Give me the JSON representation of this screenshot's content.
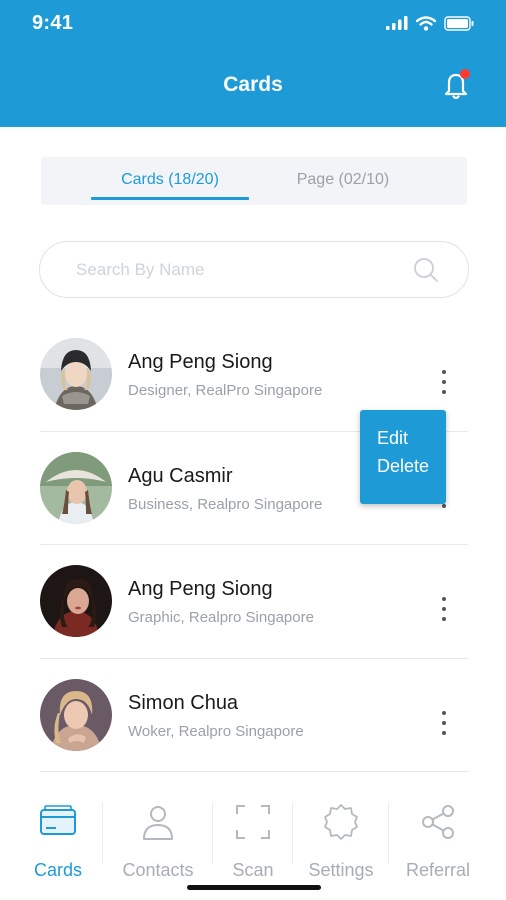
{
  "status_bar": {
    "time": "9:41"
  },
  "header": {
    "title": "Cards"
  },
  "colors": {
    "primary": "#1e9bd7",
    "notification_dot": "#ff3b30",
    "inactive": "#a7adb4"
  },
  "tabs": [
    {
      "label": "Cards (18/20)",
      "active": true
    },
    {
      "label": "Page (02/10)",
      "active": false
    }
  ],
  "search": {
    "placeholder": "Search By Name",
    "value": ""
  },
  "cards": [
    {
      "name": "Ang Peng Siong",
      "role": "Designer, RealPro Singapore"
    },
    {
      "name": "Agu Casmir",
      "role": "Business, Realpro Singapore"
    },
    {
      "name": "Ang Peng Siong",
      "role": "Graphic, Realpro Singapore"
    },
    {
      "name": "Simon Chua",
      "role": "Woker, Realpro Singapore"
    }
  ],
  "context_menu": {
    "edit": "Edit",
    "delete": "Delete"
  },
  "bottom_nav": [
    {
      "label": "Cards",
      "icon": "cards-icon",
      "active": true
    },
    {
      "label": "Contacts",
      "icon": "person-icon",
      "active": false
    },
    {
      "label": "Scan",
      "icon": "scan-icon",
      "active": false
    },
    {
      "label": "Settings",
      "icon": "gear-icon",
      "active": false
    },
    {
      "label": "Referral",
      "icon": "share-icon",
      "active": false
    }
  ]
}
